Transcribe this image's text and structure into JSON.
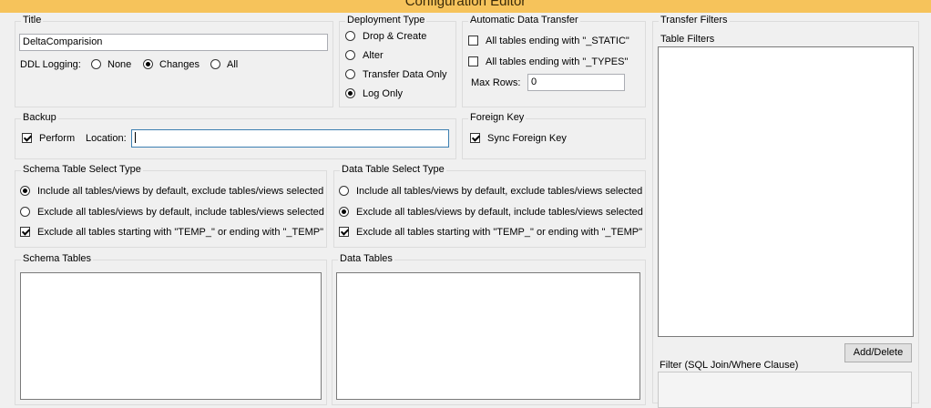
{
  "window": {
    "title": "Configuration Editor"
  },
  "title_group": {
    "label": "Title",
    "title_value": "DeltaComparision",
    "ddl_label": "DDL Logging:",
    "options": [
      "None",
      "Changes",
      "All"
    ],
    "selected": "Changes"
  },
  "deployment": {
    "label": "Deployment Type",
    "options": [
      "Drop & Create",
      "Alter",
      "Transfer Data Only",
      "Log Only"
    ],
    "selected": "Log Only"
  },
  "auto_transfer": {
    "label": "Automatic Data Transfer",
    "static_label": "All tables ending with \"_STATIC\"",
    "static_checked": false,
    "types_label": "All tables ending with \"_TYPES\"",
    "types_checked": false,
    "max_rows_label": "Max Rows:",
    "max_rows_value": "0"
  },
  "backup": {
    "label": "Backup",
    "perform_label": "Perform",
    "perform_checked": true,
    "location_label": "Location:",
    "location_value": ""
  },
  "foreign_key": {
    "label": "Foreign Key",
    "sync_label": "Sync Foreign Key",
    "sync_checked": true
  },
  "schema_select": {
    "label": "Schema Table Select Type",
    "include_label": "Include all tables/views by default, exclude tables/views selected",
    "exclude_label": "Exclude all tables/views by default, include tables/views selected",
    "selected": "include",
    "temp_label": "Exclude all tables starting with \"TEMP_\" or ending with \"_TEMP\"",
    "temp_checked": true
  },
  "data_select": {
    "label": "Data Table Select Type",
    "include_label": "Include all tables/views by default, exclude tables/views selected",
    "exclude_label": "Exclude all tables/views by default, include tables/views selected",
    "selected": "exclude",
    "temp_label": "Exclude all tables starting with \"TEMP_\" or ending with \"_TEMP\"",
    "temp_checked": true
  },
  "schema_tables": {
    "label": "Schema Tables"
  },
  "data_tables": {
    "label": "Data Tables"
  },
  "transfer_filters": {
    "label": "Transfer Filters",
    "table_filters_label": "Table Filters",
    "add_delete_label": "Add/Delete",
    "filter_label": "Filter (SQL Join/Where Clause)"
  }
}
